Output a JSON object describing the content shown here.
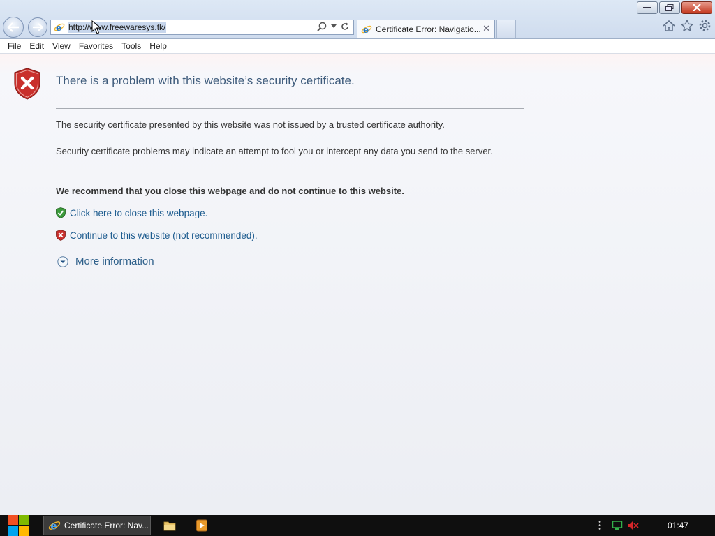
{
  "browser": {
    "address": "http://www.freewaresys.tk/",
    "tab_title": "Certificate Error: Navigatio...",
    "tab_close": "✕"
  },
  "menu": [
    "File",
    "Edit",
    "View",
    "Favorites",
    "Tools",
    "Help"
  ],
  "page": {
    "title": "There is a problem with this website’s security certificate.",
    "para1": "The security certificate presented by this website was not issued by a trusted certificate authority.",
    "para2": "Security certificate problems may indicate an attempt to fool you or intercept any data you send to the server.",
    "recommend": "We recommend that you close this webpage and do not continue to this website.",
    "close_link": "Click here to close this webpage.",
    "continue_link": "Continue to this website (not recommended).",
    "more_info": "More information"
  },
  "taskbar": {
    "ie_label": "Certificate Error: Nav...",
    "clock": "01:47"
  },
  "colors": {
    "title": "#3f5c7c",
    "link": "#1c5b8e",
    "shield_red": "#c9302c",
    "shield_green": "#3c9a3c"
  }
}
